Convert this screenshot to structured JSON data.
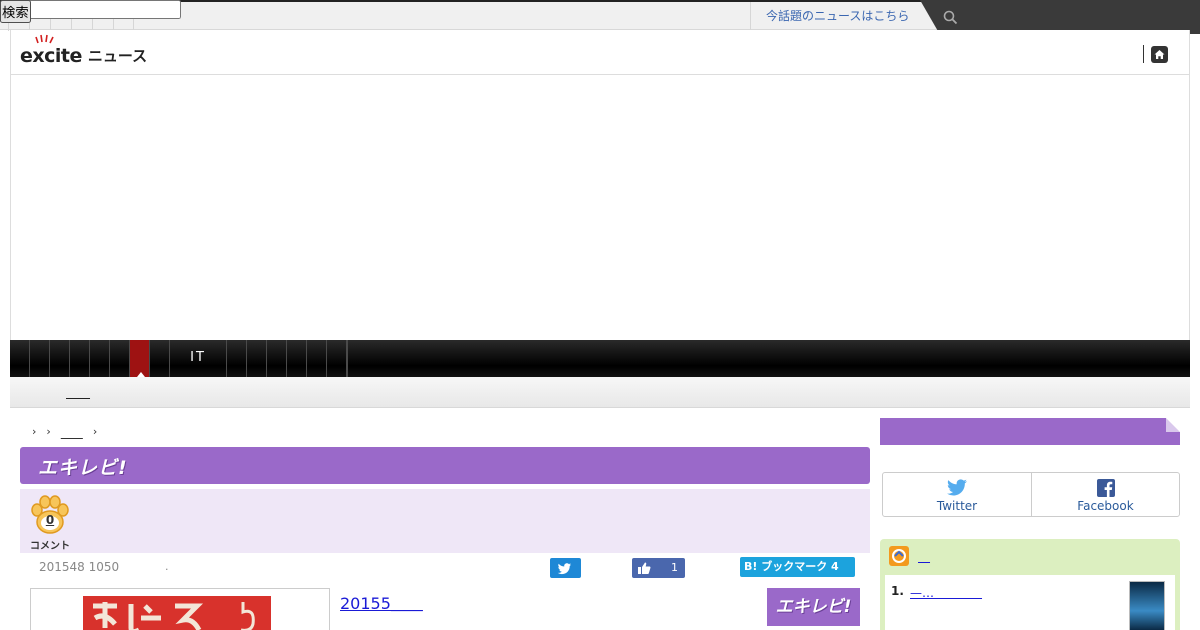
{
  "topbar": {
    "hot_news_link": "今話題のニュースはこちら",
    "search_placeholder": "",
    "search_button": "検索"
  },
  "header": {
    "logo_brand": "excite",
    "logo_section": "ニュース"
  },
  "category_nav": {
    "items": [
      "",
      "",
      "",
      "",
      "",
      "",
      "",
      "",
      "IT",
      "",
      "",
      "",
      "",
      "",
      "",
      ""
    ],
    "active_index": 5
  },
  "sub_nav": {
    "link": "＿＿"
  },
  "breadcrumb": {
    "items": [
      "",
      "",
      "＿＿",
      ""
    ]
  },
  "series": {
    "logo": "エキレビ!"
  },
  "comments": {
    "count": "0",
    "label": "コメント"
  },
  "article": {
    "date": "201548 1050",
    "dot": ".",
    "like_count": "1",
    "hatena_label": "B! ブックマーク 4",
    "title": "20155＿＿",
    "series_badge": "エキレビ!"
  },
  "sidebar": {
    "share_twitter": "Twitter",
    "share_facebook": "Facebook",
    "ranking_title": "＿",
    "ranking_items": [
      {
        "rank": "1.",
        "title": "—…＿＿＿＿"
      }
    ]
  },
  "colors": {
    "series_purple": "#9a69c9",
    "search_red": "#c22e2e",
    "active_category": "#9e1212",
    "twitter_blue": "#1e88d6",
    "facebook_blue": "#4a67ad",
    "hatena_blue": "#1ca3dd",
    "ranking_green": "#dcefc0"
  }
}
